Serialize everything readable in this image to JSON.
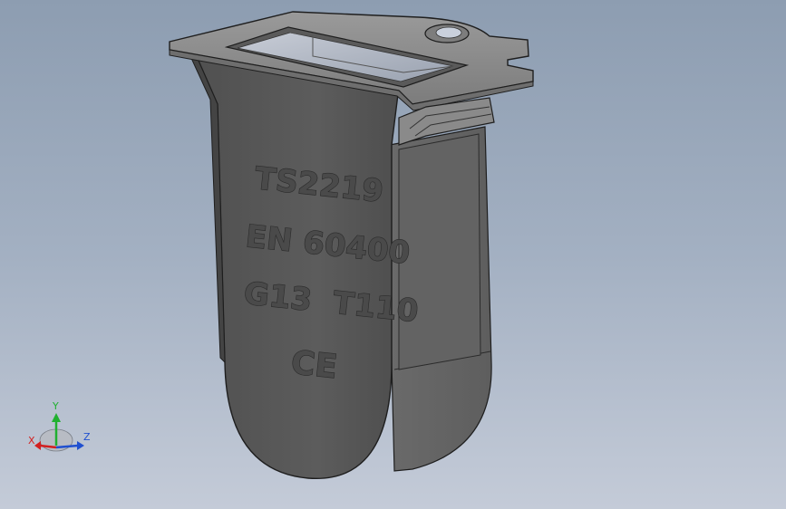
{
  "model": {
    "engravings": [
      "TS2219",
      "EN 60400",
      "G13  T110",
      "CE"
    ]
  },
  "triad": {
    "x_label": "X",
    "y_label": "Y",
    "z_label": "Z",
    "x_color": "#d22020",
    "y_color": "#20b030",
    "z_color": "#2050d0"
  },
  "colors": {
    "background_top": "#8d9db1",
    "background_bottom": "#c4cbd8",
    "part_body": "#595959",
    "part_edge": "#1e1e1e"
  }
}
